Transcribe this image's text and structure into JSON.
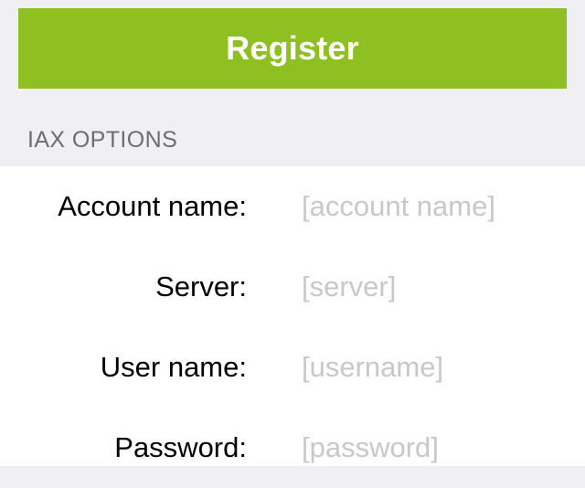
{
  "register_button": {
    "label": "Register",
    "color": "#8fc021"
  },
  "section": {
    "header": "IAX OPTIONS"
  },
  "fields": [
    {
      "label": "Account name:",
      "placeholder": "[account name]",
      "value": ""
    },
    {
      "label": "Server:",
      "placeholder": "[server]",
      "value": ""
    },
    {
      "label": "User name:",
      "placeholder": "[username]",
      "value": ""
    },
    {
      "label": "Password:",
      "placeholder": "[password]",
      "value": ""
    }
  ]
}
